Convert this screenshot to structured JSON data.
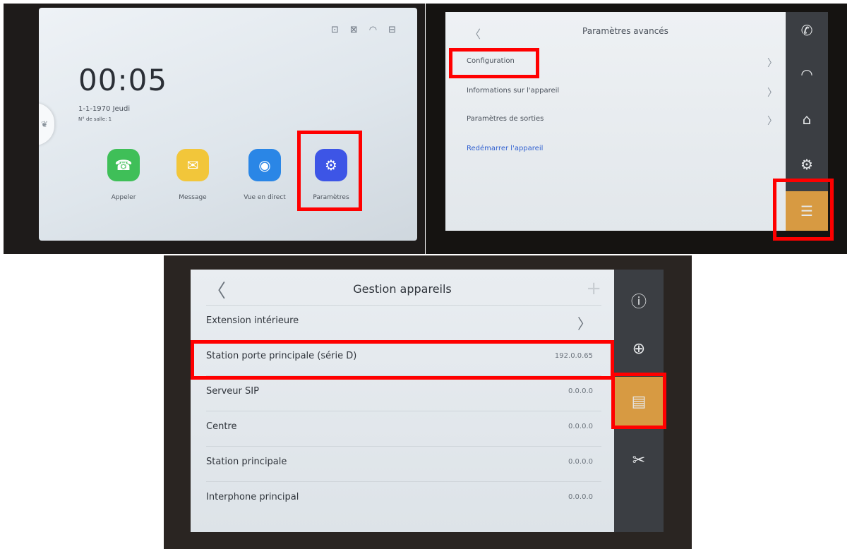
{
  "home": {
    "status_icons": [
      "⊡",
      "⊠",
      "◠",
      "⊟"
    ],
    "time": "00:05",
    "date": "1-1-1970 Jeudi",
    "room": "N° de salle: 1",
    "apps": [
      {
        "label": "Appeler",
        "icon": "☎"
      },
      {
        "label": "Message",
        "icon": "✉"
      },
      {
        "label": "Vue en direct",
        "icon": "◉"
      },
      {
        "label": "Paramètres",
        "icon": "⚙"
      }
    ]
  },
  "advanced": {
    "title": "Paramètres avancés",
    "back_icon": "〈",
    "rows": [
      {
        "label": "Configuration",
        "chevron": "〉"
      },
      {
        "label": "Informations sur l'appareil",
        "chevron": "〉"
      },
      {
        "label": "Paramètres de sorties",
        "chevron": "〉"
      },
      {
        "label": "Redémarrer l'appareil"
      }
    ],
    "sidebar_icons": [
      "✆",
      "◠",
      "⌂",
      "⚙",
      "☰"
    ]
  },
  "devices": {
    "title": "Gestion appareils",
    "back_icon": "〈",
    "add_icon": "+",
    "rows": [
      {
        "name": "Extension intérieure",
        "chevron": "〉"
      },
      {
        "name": "Station porte principale (série D)",
        "value": "192.0.0.65"
      },
      {
        "name": "Serveur SIP",
        "value": "0.0.0.0"
      },
      {
        "name": "Centre",
        "value": "0.0.0.0"
      },
      {
        "name": "Station principale",
        "value": "0.0.0.0"
      },
      {
        "name": "Interphone principal",
        "value": "0.0.0.0"
      }
    ],
    "sidebar_icons": [
      "ⓘ",
      "⊕",
      "▤",
      "✂"
    ]
  },
  "colors": {
    "highlight": "#ff0000",
    "active_tab": "#d79a42",
    "sidebar": "#3b3e43"
  }
}
